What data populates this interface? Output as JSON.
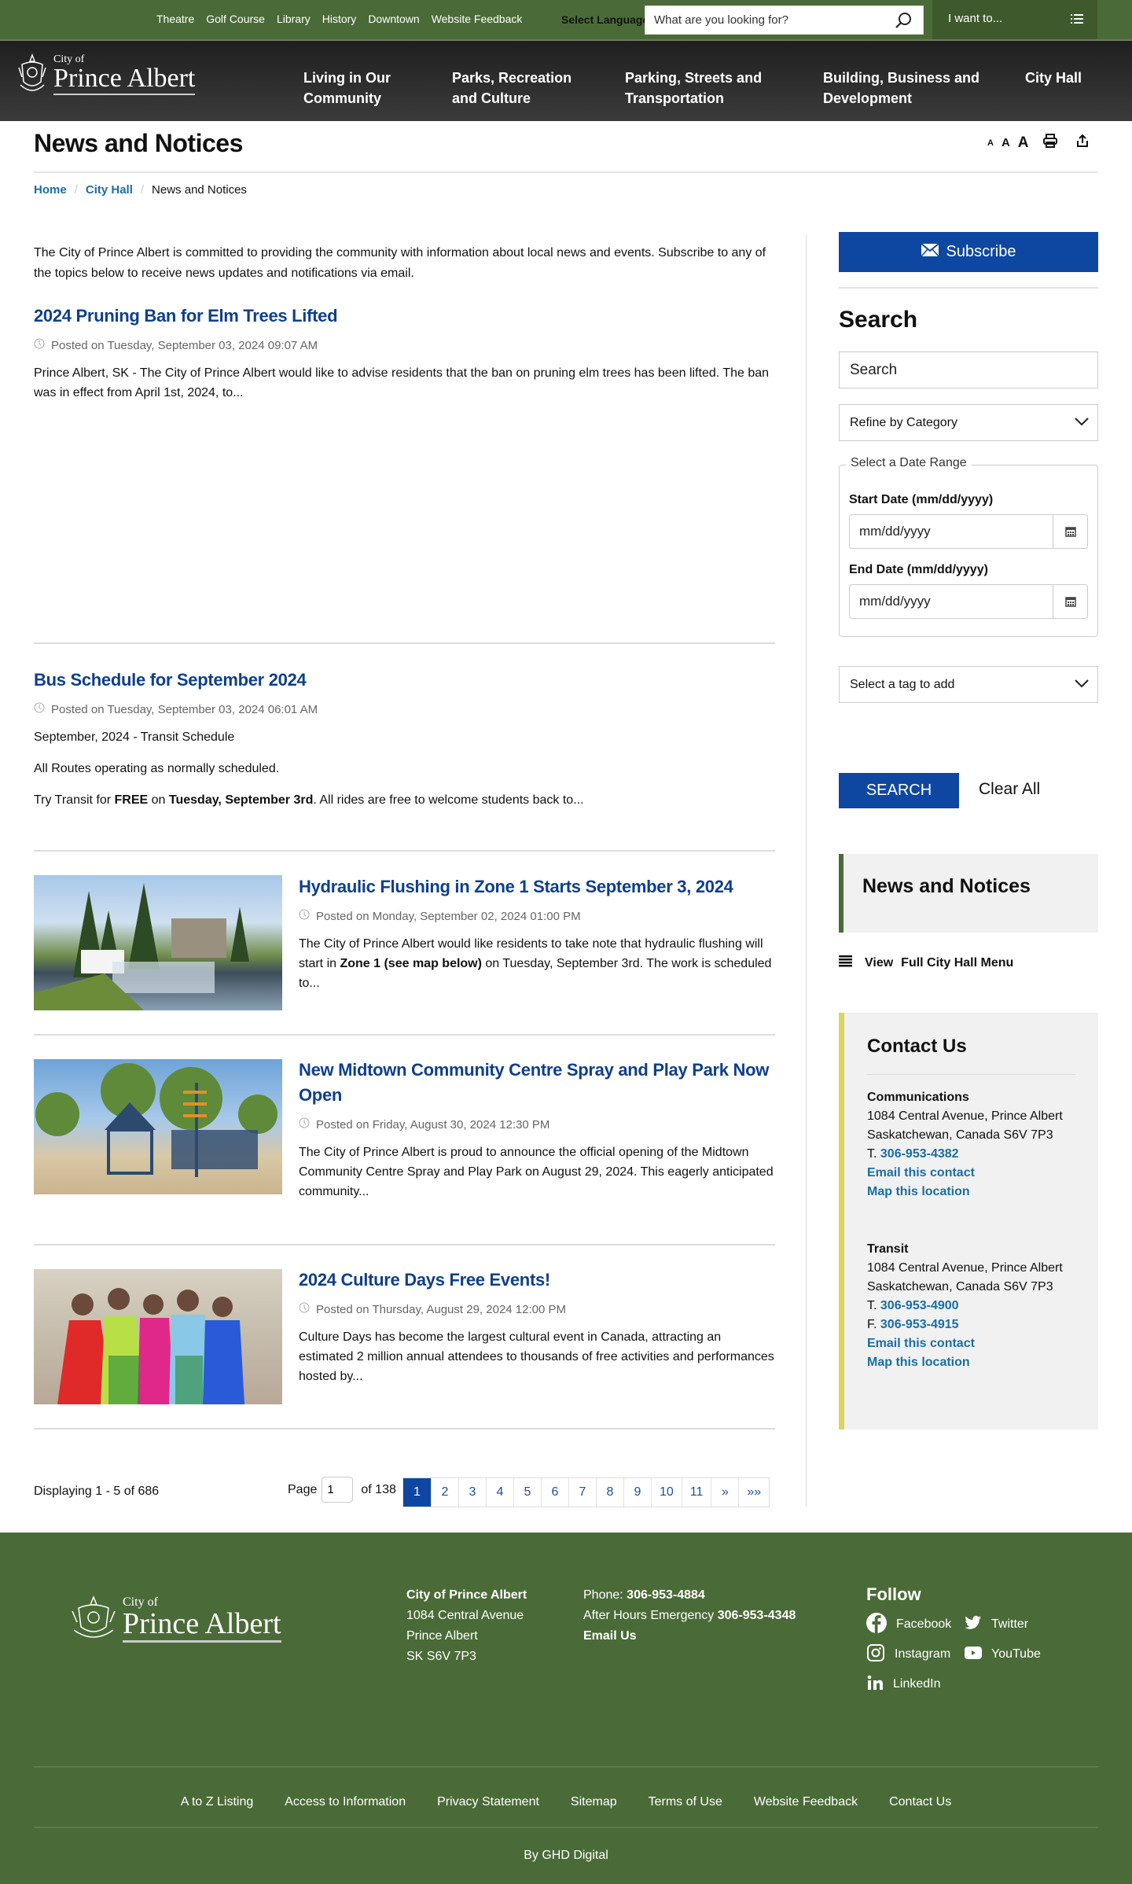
{
  "topbar": {
    "links": [
      "Theatre",
      "Golf Course",
      "Library",
      "History",
      "Downtown",
      "Website Feedback"
    ],
    "select_language": "Select Language",
    "search_placeholder": "What are you looking for?",
    "i_want_to": "I want to..."
  },
  "logo": {
    "city_of": "City of",
    "name": "Prince Albert"
  },
  "nav": {
    "items": [
      {
        "label": "Living in Our Community"
      },
      {
        "label": "Parks, Recreation and Culture"
      },
      {
        "label": "Parking, Streets and Transportation"
      },
      {
        "label": "Building, Business and Development"
      },
      {
        "label": "City Hall"
      }
    ]
  },
  "page": {
    "title": "News and Notices",
    "text_size": {
      "small": "A",
      "medium": "A",
      "large": "A"
    }
  },
  "breadcrumb": {
    "home": "Home",
    "city_hall": "City Hall",
    "current": "News and Notices",
    "sep": "/"
  },
  "intro": "The City of Prince Albert is committed to providing the community with information about local news and events. Subscribe to any of the topics below to receive news updates and notifications via email.",
  "articles": [
    {
      "title": "2024 Pruning Ban for Elm Trees Lifted",
      "date": "Posted on Tuesday, September 03, 2024 09:07 AM",
      "body": "Prince Albert, SK - The City of Prince Albert would like to advise residents that the ban on pruning elm trees has been lifted. The ban was in effect from April 1st, 2024, to..."
    },
    {
      "title": "Bus Schedule for September 2024",
      "date": "Posted on Tuesday, September 03, 2024 06:01 AM",
      "p1": "September, 2024 - Transit Schedule",
      "p2": "All Routes operating as normally scheduled.",
      "p3_a": "Try Transit for ",
      "p3_b": "FREE",
      "p3_c": " on ",
      "p3_d": "Tuesday, September 3rd",
      "p3_e": ". All rides are free to welcome students back to..."
    },
    {
      "title": "Hydraulic Flushing in Zone 1 Starts September 3, 2024",
      "date": "Posted on Monday, September 02, 2024 01:00 PM",
      "body_a": "The City of Prince Albert would like residents to take note that hydraulic flushing will start in ",
      "body_b": "Zone 1 (see map below)",
      "body_c": " on Tuesday, September 3rd. The work is scheduled to..."
    },
    {
      "title": "New Midtown Community Centre Spray and Play Park Now Open",
      "date": "Posted on Friday, August 30, 2024 12:30 PM",
      "body": "The City of Prince Albert is proud to announce the official opening of the Midtown Community Centre Spray and Play Park on August 29, 2024. This eagerly anticipated community..."
    },
    {
      "title": "2024 Culture Days Free Events!",
      "date": "Posted on Thursday, August 29, 2024 12:00 PM",
      "body": "Culture Days has become the largest cultural event in Canada, attracting an estimated 2 million annual attendees to thousands of free activities and performances hosted by..."
    }
  ],
  "pagination": {
    "displaying": "Displaying 1 - 5 of 686",
    "page_label": "Page",
    "page_value": "1",
    "of_total": "of 138",
    "pages": [
      "1",
      "2",
      "3",
      "4",
      "5",
      "6",
      "7",
      "8",
      "9",
      "10",
      "11"
    ],
    "next": "»",
    "last": "»»",
    "current": "1"
  },
  "sidebar": {
    "subscribe": "Subscribe",
    "search_heading": "Search",
    "search_placeholder": "Search",
    "category": "Refine by Category",
    "date_range_legend": "Select a Date Range",
    "start_label": "Start Date (mm/dd/yyyy)",
    "start_placeholder": "mm/dd/yyyy",
    "end_label": "End Date (mm/dd/yyyy)",
    "end_placeholder": "mm/dd/yyyy",
    "tag": "Select a tag to add",
    "search_btn": "SEARCH",
    "clear_all": "Clear All",
    "section_title": "News and Notices",
    "view": "View",
    "full_menu": "Full City Hall Menu"
  },
  "contact": {
    "heading": "Contact Us",
    "blocks": [
      {
        "name": "Communications",
        "addr1": "1084 Central Avenue, Prince Albert",
        "addr2": "Saskatchewan, Canada S6V 7P3",
        "t_label": "T.",
        "phone": "306-953-4382",
        "email": "Email this contact",
        "map": "Map this location"
      },
      {
        "name": "Transit",
        "addr1": "1084 Central Avenue, Prince Albert",
        "addr2": "Saskatchewan, Canada S6V 7P3",
        "t_label": "T.",
        "phone": "306-953-4900",
        "f_label": "F.",
        "fax": "306-953-4915",
        "email": "Email this contact",
        "map": "Map this location"
      }
    ]
  },
  "footer": {
    "org": "City of Prince Albert",
    "addr1": "1084 Central Avenue",
    "addr2": "Prince Albert",
    "addr3": "SK S6V 7P3",
    "phone_label": "Phone:",
    "phone": "306-953-4884",
    "emergency_label": "After Hours Emergency",
    "emergency": "306-953-4348",
    "email": "Email Us",
    "follow": "Follow",
    "social": [
      "Facebook",
      "Twitter",
      "Instagram",
      "YouTube",
      "LinkedIn"
    ],
    "links": [
      "A to Z Listing",
      "Access to Information",
      "Privacy Statement",
      "Sitemap",
      "Terms of Use",
      "Website Feedback",
      "Contact Us"
    ],
    "credit": "By GHD Digital"
  },
  "colors": {
    "brand_green": "#4a6b37",
    "primary_blue": "#0e47a1",
    "link_blue": "#1a6ea3",
    "title_blue": "#0f3f8c",
    "contact_accent": "#d9d55f"
  }
}
